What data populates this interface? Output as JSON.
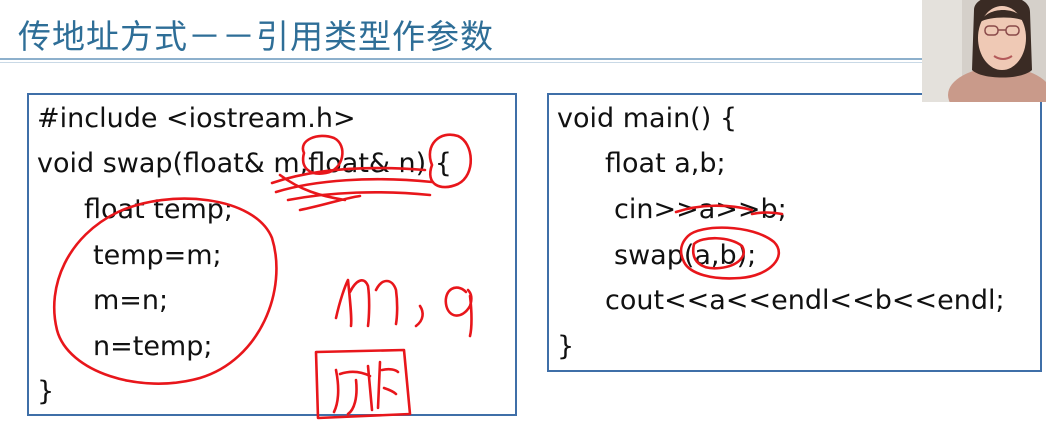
{
  "slide": {
    "title": "传地址方式－－引用类型作参数"
  },
  "left_code": {
    "lines": [
      "#include <iostream.h>",
      "void swap(float& m,float& n) {",
      "float temp;",
      "temp=m;",
      "m=n;",
      "n=temp;",
      "}"
    ]
  },
  "right_code": {
    "lines": [
      "void main() {",
      "float a,b;",
      "cin>>a>>b;",
      "swap(a,b);",
      "cout<<a<<endl<<b<<endl;",
      "}"
    ]
  },
  "colors": {
    "title": "#2e6e97",
    "box_border": "#3f6fa8",
    "ink": "#e8161b"
  }
}
